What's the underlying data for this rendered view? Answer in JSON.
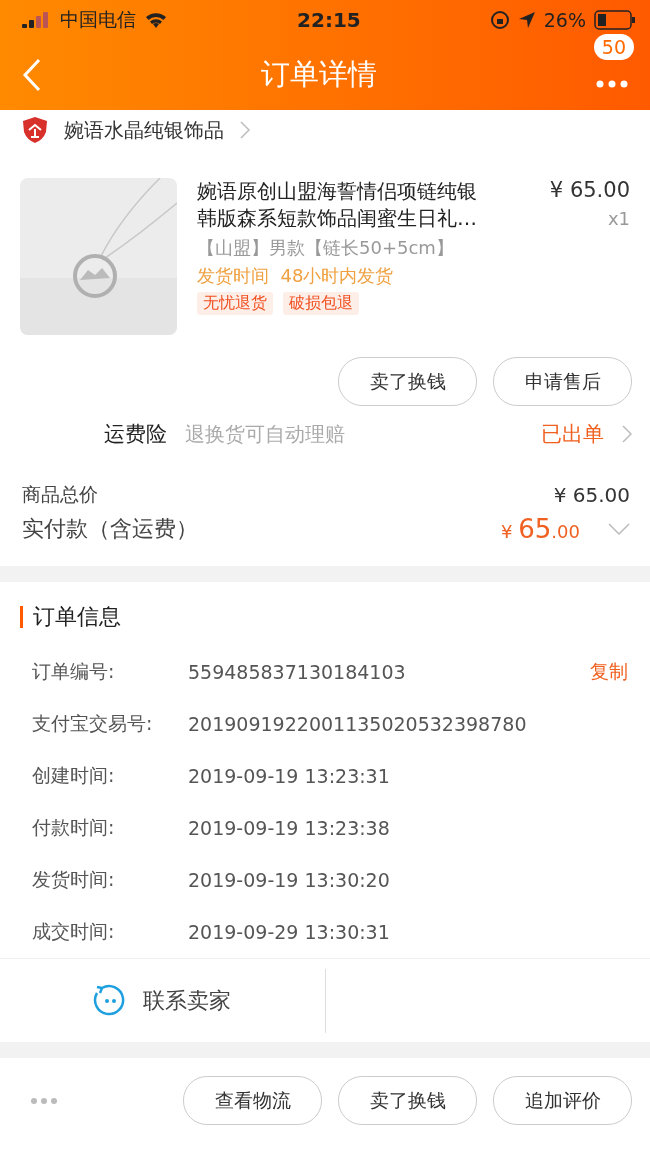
{
  "status_bar": {
    "carrier": "中国电信",
    "time": "22:15",
    "battery": "26%"
  },
  "nav": {
    "title": "订单详情",
    "badge": "50"
  },
  "shop": {
    "name": "婉语水晶纯银饰品"
  },
  "product": {
    "title": "婉语原创山盟海誓情侣项链纯银韩版森系短款饰品闺蜜生日礼…",
    "price": "¥ 65.00",
    "quantity": "x1",
    "spec": "【山盟】男款【链长50+5cm】",
    "shipping": "发货时间  48小时内发货",
    "tags": [
      "无忧退货",
      "破损包退"
    ]
  },
  "item_actions": [
    "卖了换钱",
    "申请售后"
  ],
  "insurance": {
    "label": "运费险",
    "desc": "退换货可自动理赔",
    "status": "已出单"
  },
  "totals": {
    "goods_label": "商品总价",
    "goods_value": "¥ 65.00",
    "paid_label": "实付款（含运费）",
    "paid_currency": "¥",
    "paid_int": "65",
    "paid_dec": ".00"
  },
  "order_info": {
    "title": "订单信息",
    "rows": [
      {
        "label": "订单编号:",
        "value": "559485837130184103",
        "action": "复制"
      },
      {
        "label": "支付宝交易号:",
        "value": "2019091922001135020532398780"
      },
      {
        "label": "创建时间:",
        "value": "2019-09-19 13:23:31"
      },
      {
        "label": "付款时间:",
        "value": "2019-09-19 13:23:38"
      },
      {
        "label": "发货时间:",
        "value": "2019-09-19 13:30:20"
      },
      {
        "label": "成交时间:",
        "value": "2019-09-29 13:30:31"
      }
    ]
  },
  "contact": {
    "label": "联系卖家"
  },
  "bottom_actions": [
    "查看物流",
    "卖了换钱",
    "追加评价"
  ]
}
